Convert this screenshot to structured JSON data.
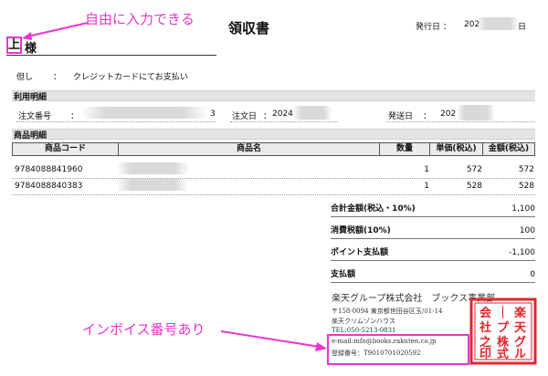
{
  "annotations": {
    "free_input": "自由に入力できる",
    "invoice_note": "インボイス番号あり"
  },
  "header": {
    "title": "領収書",
    "issue_date_label": "発行日 ：",
    "issue_date_prefix": "202",
    "issue_date_suffix": "日"
  },
  "recipient": {
    "name": "上",
    "honorific": "様"
  },
  "proviso": {
    "label": "但し",
    "colon": "：",
    "text": "クレジットカードにてお支払い"
  },
  "usage": {
    "section_title": "利用明細",
    "order_number_label": "注文番号",
    "order_number_colon": "：",
    "order_number_suffix": "3",
    "order_date_label": "注文日",
    "order_date_colon": "：",
    "order_date_prefix": "2024",
    "ship_date_label": "発送日",
    "ship_date_colon": "：",
    "ship_date_prefix": "202"
  },
  "items": {
    "section_title": "商品明細",
    "columns": {
      "code": "商品コード",
      "name": "商品名",
      "qty": "数量",
      "unit_price": "単価(税込)",
      "amount": "金額(税込)"
    },
    "rows": [
      {
        "code": "9784088841960",
        "qty": "1",
        "unit_price": "572",
        "amount": "572"
      },
      {
        "code": "9784088840383",
        "qty": "1",
        "unit_price": "528",
        "amount": "528"
      }
    ]
  },
  "totals": {
    "total_label": "合計金額(税込・10%)",
    "total_value": "1,100",
    "tax_label": "消費税額(10%)",
    "tax_value": "100",
    "points_label": "ポイント支払額",
    "points_value": "-1,100",
    "paid_label": "支払額",
    "paid_value": "0"
  },
  "issuer": {
    "company": "楽天グループ株式会社　ブックス事業部",
    "address": "〒158-0094 東京都世田谷区玉川1-14",
    "building": "楽天クリムゾンハウス",
    "tel": "TEL:050-5213-0831",
    "email": "e-mail:info@books.rakuten.co.jp",
    "registration": "登録番号：T9010701020592"
  },
  "seal": {
    "text": "楽天グループ株式会社"
  },
  "colors": {
    "annotation": "#ec34d2",
    "seal": "#e0262e",
    "header_fill": "#e4e4e4"
  }
}
